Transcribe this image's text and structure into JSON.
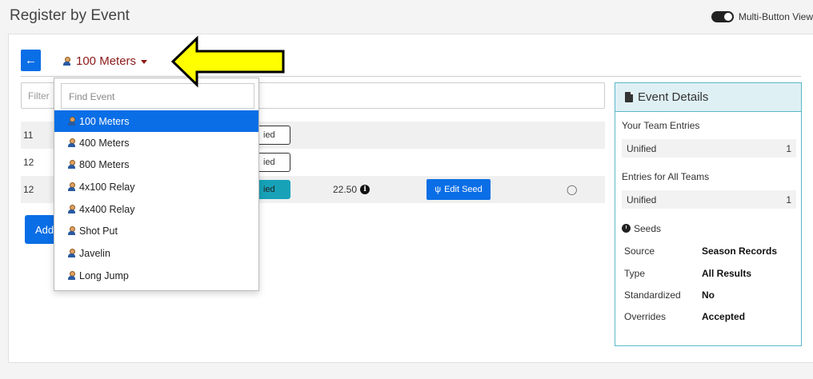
{
  "header": {
    "title": "Register by Event",
    "multi_button_view_label": "Multi-Button View",
    "multi_button_view_on": true
  },
  "event_selector": {
    "current_event": "100 Meters",
    "back_icon": "arrow-left-icon"
  },
  "filter": {
    "placeholder": "Filter"
  },
  "rows": [
    {
      "num": "11",
      "division": "ied",
      "seed": "",
      "edit_label": ""
    },
    {
      "num": "12",
      "division": "ied",
      "seed": "",
      "edit_label": ""
    },
    {
      "num": "12",
      "division": "ied",
      "seed": "22.50",
      "edit_label": "Edit Seed"
    }
  ],
  "add_button": {
    "label": "Add"
  },
  "dropdown": {
    "search_placeholder": "Find Event",
    "items": [
      "100 Meters",
      "400 Meters",
      "800 Meters",
      "4x100 Relay",
      "4x400 Relay",
      "Shot Put",
      "Javelin",
      "Long Jump"
    ],
    "selected_index": 0
  },
  "event_details": {
    "title": "Event Details",
    "your_team_entries_label": "Your Team Entries",
    "your_team": {
      "name": "Unified",
      "count": "1"
    },
    "all_teams_label": "Entries for All Teams",
    "all_teams": {
      "name": "Unified",
      "count": "1"
    },
    "seeds_label": "Seeds",
    "seeds": {
      "source_label": "Source",
      "source": "Season Records",
      "type_label": "Type",
      "type": "All Results",
      "standardized_label": "Standardized",
      "standardized": "No",
      "overrides_label": "Overrides",
      "overrides": "Accepted"
    }
  },
  "colors": {
    "primary": "#0a6ee6",
    "accent_teal": "#17a2b8",
    "event_title": "#8b1a1a",
    "callout_arrow": "#ffff00"
  }
}
